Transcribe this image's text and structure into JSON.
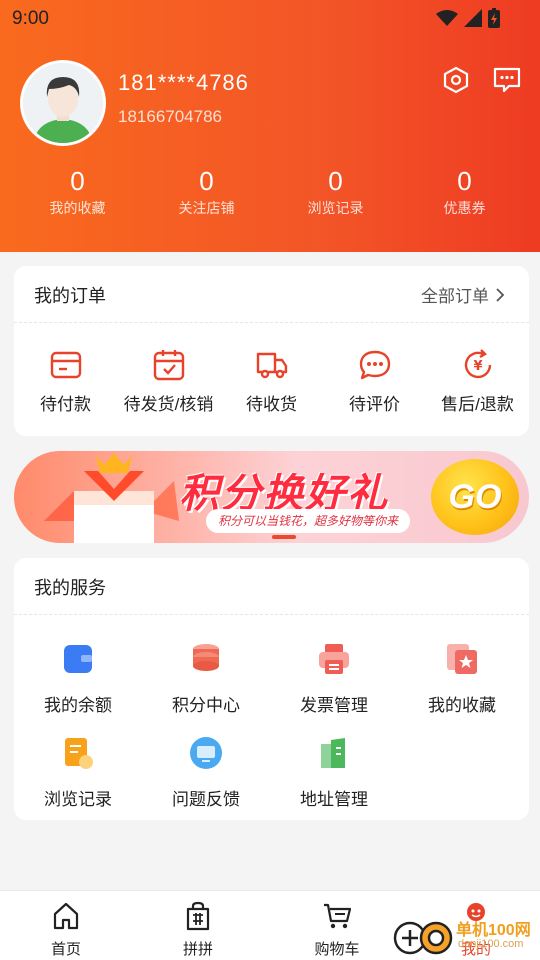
{
  "status_bar": {
    "time": "9:00"
  },
  "profile": {
    "masked_phone": "181****4786",
    "phone": "18166704786"
  },
  "stats": [
    {
      "value": "0",
      "label": "我的收藏"
    },
    {
      "value": "0",
      "label": "关注店铺"
    },
    {
      "value": "0",
      "label": "浏览记录"
    },
    {
      "value": "0",
      "label": "优惠券"
    }
  ],
  "orders": {
    "title": "我的订单",
    "all_label": "全部订单",
    "items": [
      {
        "label": "待付款",
        "icon": "wallet-icon"
      },
      {
        "label": "待发货/核销",
        "icon": "calendar-check-icon"
      },
      {
        "label": "待收货",
        "icon": "truck-icon"
      },
      {
        "label": "待评价",
        "icon": "chat-bubble-icon"
      },
      {
        "label": "售后/退款",
        "icon": "refund-icon"
      }
    ]
  },
  "banner": {
    "title": "积分换好礼",
    "subtitle": "积分可以当钱花，超多好物等你来",
    "go_label": "GO"
  },
  "services": {
    "title": "我的服务",
    "items": [
      {
        "label": "我的余额",
        "icon": "balance-icon",
        "color": "#3b7cf5"
      },
      {
        "label": "积分中心",
        "icon": "points-icon",
        "color": "#ef6a55"
      },
      {
        "label": "发票管理",
        "icon": "invoice-icon",
        "color": "#f05d55"
      },
      {
        "label": "我的收藏",
        "icon": "favorite-icon",
        "color": "#f06a64"
      },
      {
        "label": "浏览记录",
        "icon": "history-icon",
        "color": "#f7a21a"
      },
      {
        "label": "问题反馈",
        "icon": "feedback-icon",
        "color": "#4aa9f0"
      },
      {
        "label": "地址管理",
        "icon": "address-icon",
        "color": "#4cb85c"
      }
    ]
  },
  "tabbar": {
    "items": [
      {
        "label": "首页",
        "icon": "home-icon"
      },
      {
        "label": "拼拼",
        "icon": "group-buy-icon"
      },
      {
        "label": "购物车",
        "icon": "cart-icon"
      },
      {
        "label": "我的",
        "icon": "profile-icon",
        "active": true
      }
    ]
  },
  "watermark": {
    "text": "单机100网",
    "url_text": "danji100.com"
  },
  "colors": {
    "accent": "#f35527",
    "header_start": "#f96a1e",
    "header_end": "#ee3b23",
    "order_icon": "#e8432a"
  }
}
